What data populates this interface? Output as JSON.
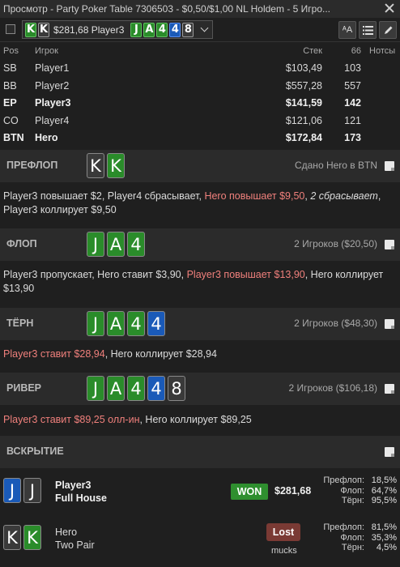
{
  "window": {
    "title": "Просмотр - Party Poker Table 7306503 - $0,50/$1,00 NL Holdem - 5 Игро..."
  },
  "toolbar": {
    "hand_cards": [
      {
        "rank": "K",
        "suit": "green"
      },
      {
        "rank": "K",
        "suit": "gray"
      }
    ],
    "stake_player": "$281,68 Player3",
    "board_cards": [
      {
        "rank": "J",
        "suit": "green"
      },
      {
        "rank": "A",
        "suit": "green"
      },
      {
        "rank": "4",
        "suit": "green"
      },
      {
        "rank": "4",
        "suit": "blue"
      },
      {
        "rank": "8",
        "suit": "gray"
      }
    ],
    "font_button": "ᴬA"
  },
  "players_table": {
    "headers": {
      "pos": "Pos",
      "player": "Игрок",
      "stack": "Стек",
      "vpip": "66",
      "notes": "Нотсы"
    },
    "rows": [
      {
        "pos": "SB",
        "name": "Player1",
        "stack": "$103,49",
        "vpip": "103",
        "bold": false
      },
      {
        "pos": "BB",
        "name": "Player2",
        "stack": "$557,28",
        "vpip": "557",
        "bold": false
      },
      {
        "pos": "EP",
        "name": "Player3",
        "stack": "$141,59",
        "vpip": "142",
        "bold": true
      },
      {
        "pos": "CO",
        "name": "Player4",
        "stack": "$121,06",
        "vpip": "121",
        "bold": false
      },
      {
        "pos": "BTN",
        "name": "Hero",
        "stack": "$172,84",
        "vpip": "173",
        "bold": true
      }
    ]
  },
  "streets": {
    "preflop": {
      "name": "ПРЕФЛОП",
      "info": "Сдано Hero в BTN",
      "cards": [
        {
          "rank": "K",
          "suit": "gray"
        },
        {
          "rank": "K",
          "suit": "green"
        }
      ],
      "actions": [
        {
          "text": "Player3 повышает $2, Player4 сбрасывает, ",
          "style": "normal"
        },
        {
          "text": "Hero повышает $9,50",
          "style": "red"
        },
        {
          "text": ", ",
          "style": "normal"
        },
        {
          "text": "2 сбрасывает",
          "style": "italic"
        },
        {
          "text": ", Player3 коллирует $9,50",
          "style": "normal"
        }
      ]
    },
    "flop": {
      "name": "ФЛОП",
      "info": "2 Игроков ($20,50)",
      "cards": [
        {
          "rank": "J",
          "suit": "green"
        },
        {
          "rank": "A",
          "suit": "green"
        },
        {
          "rank": "4",
          "suit": "green"
        }
      ],
      "actions": [
        {
          "text": "Player3 пропускает, Hero ставит $3,90, ",
          "style": "normal"
        },
        {
          "text": "Player3 повышает $13,90",
          "style": "red"
        },
        {
          "text": ", Hero коллирует $13,90",
          "style": "normal"
        }
      ]
    },
    "turn": {
      "name": "ТЁРН",
      "info": "2 Игроков ($48,30)",
      "cards": [
        {
          "rank": "J",
          "suit": "green"
        },
        {
          "rank": "A",
          "suit": "green"
        },
        {
          "rank": "4",
          "suit": "green"
        },
        {
          "rank": "4",
          "suit": "blue"
        }
      ],
      "actions": [
        {
          "text": "Player3 ставит $28,94",
          "style": "red"
        },
        {
          "text": ", Hero коллирует $28,94",
          "style": "normal"
        }
      ]
    },
    "river": {
      "name": "РИВЕР",
      "info": "2 Игроков ($106,18)",
      "cards": [
        {
          "rank": "J",
          "suit": "green"
        },
        {
          "rank": "A",
          "suit": "green"
        },
        {
          "rank": "4",
          "suit": "green"
        },
        {
          "rank": "4",
          "suit": "blue"
        },
        {
          "rank": "8",
          "suit": "gray"
        }
      ],
      "actions": [
        {
          "text": "Player3 ставит $89,25 олл-ин",
          "style": "red"
        },
        {
          "text": ", Hero коллирует $89,25",
          "style": "normal"
        }
      ]
    }
  },
  "showdown": {
    "title": "ВСКРЫТИЕ",
    "players": [
      {
        "name": "Player3",
        "hand": "Full House",
        "cards": [
          {
            "rank": "J",
            "suit": "blue"
          },
          {
            "rank": "J",
            "suit": "gray"
          }
        ],
        "result": "WON",
        "amount": "$281,68",
        "equity": [
          {
            "label": "Префлоп:",
            "value": "18,5%"
          },
          {
            "label": "Флоп:",
            "value": "64,7%"
          },
          {
            "label": "Тёрн:",
            "value": "95,5%"
          }
        ]
      },
      {
        "name": "Hero",
        "hand": "Two Pair",
        "cards": [
          {
            "rank": "K",
            "suit": "gray"
          },
          {
            "rank": "K",
            "suit": "green"
          }
        ],
        "result": "Lost",
        "sub": "mucks",
        "equity": [
          {
            "label": "Префлоп:",
            "value": "81,5%"
          },
          {
            "label": "Флоп:",
            "value": "35,3%"
          },
          {
            "label": "Тёрн:",
            "value": "4,5%"
          }
        ]
      }
    ]
  }
}
